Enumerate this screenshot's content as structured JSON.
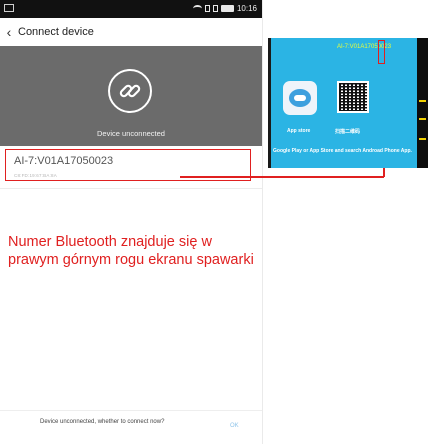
{
  "status_bar": {
    "time": "10:16"
  },
  "header": {
    "title": "Connect device"
  },
  "banner": {
    "status": "Device unconnected"
  },
  "device": {
    "name": "AI-7:V01A17050023",
    "mac": "C8:FD:19:67:BA:8A"
  },
  "annotation": {
    "text": "Numer Bluetooth znajduje się w prawym górnym rogu ekranu spawarki"
  },
  "footer": {
    "message": "Device unconnected, whether to connect now?",
    "ok_label": "OK"
  },
  "welder_screen": {
    "device_id": "AI-7:V01A17050023",
    "app_store_label": "App store",
    "qr_label": "扫描二维码",
    "instruction": "Google Play or App Store and search Androad Phone App."
  },
  "colors": {
    "accent_red": "#e02020",
    "banner_gray": "#6b6b6b",
    "welder_blue": "#2bb4e4",
    "ok_blue": "#8fc5ea"
  }
}
